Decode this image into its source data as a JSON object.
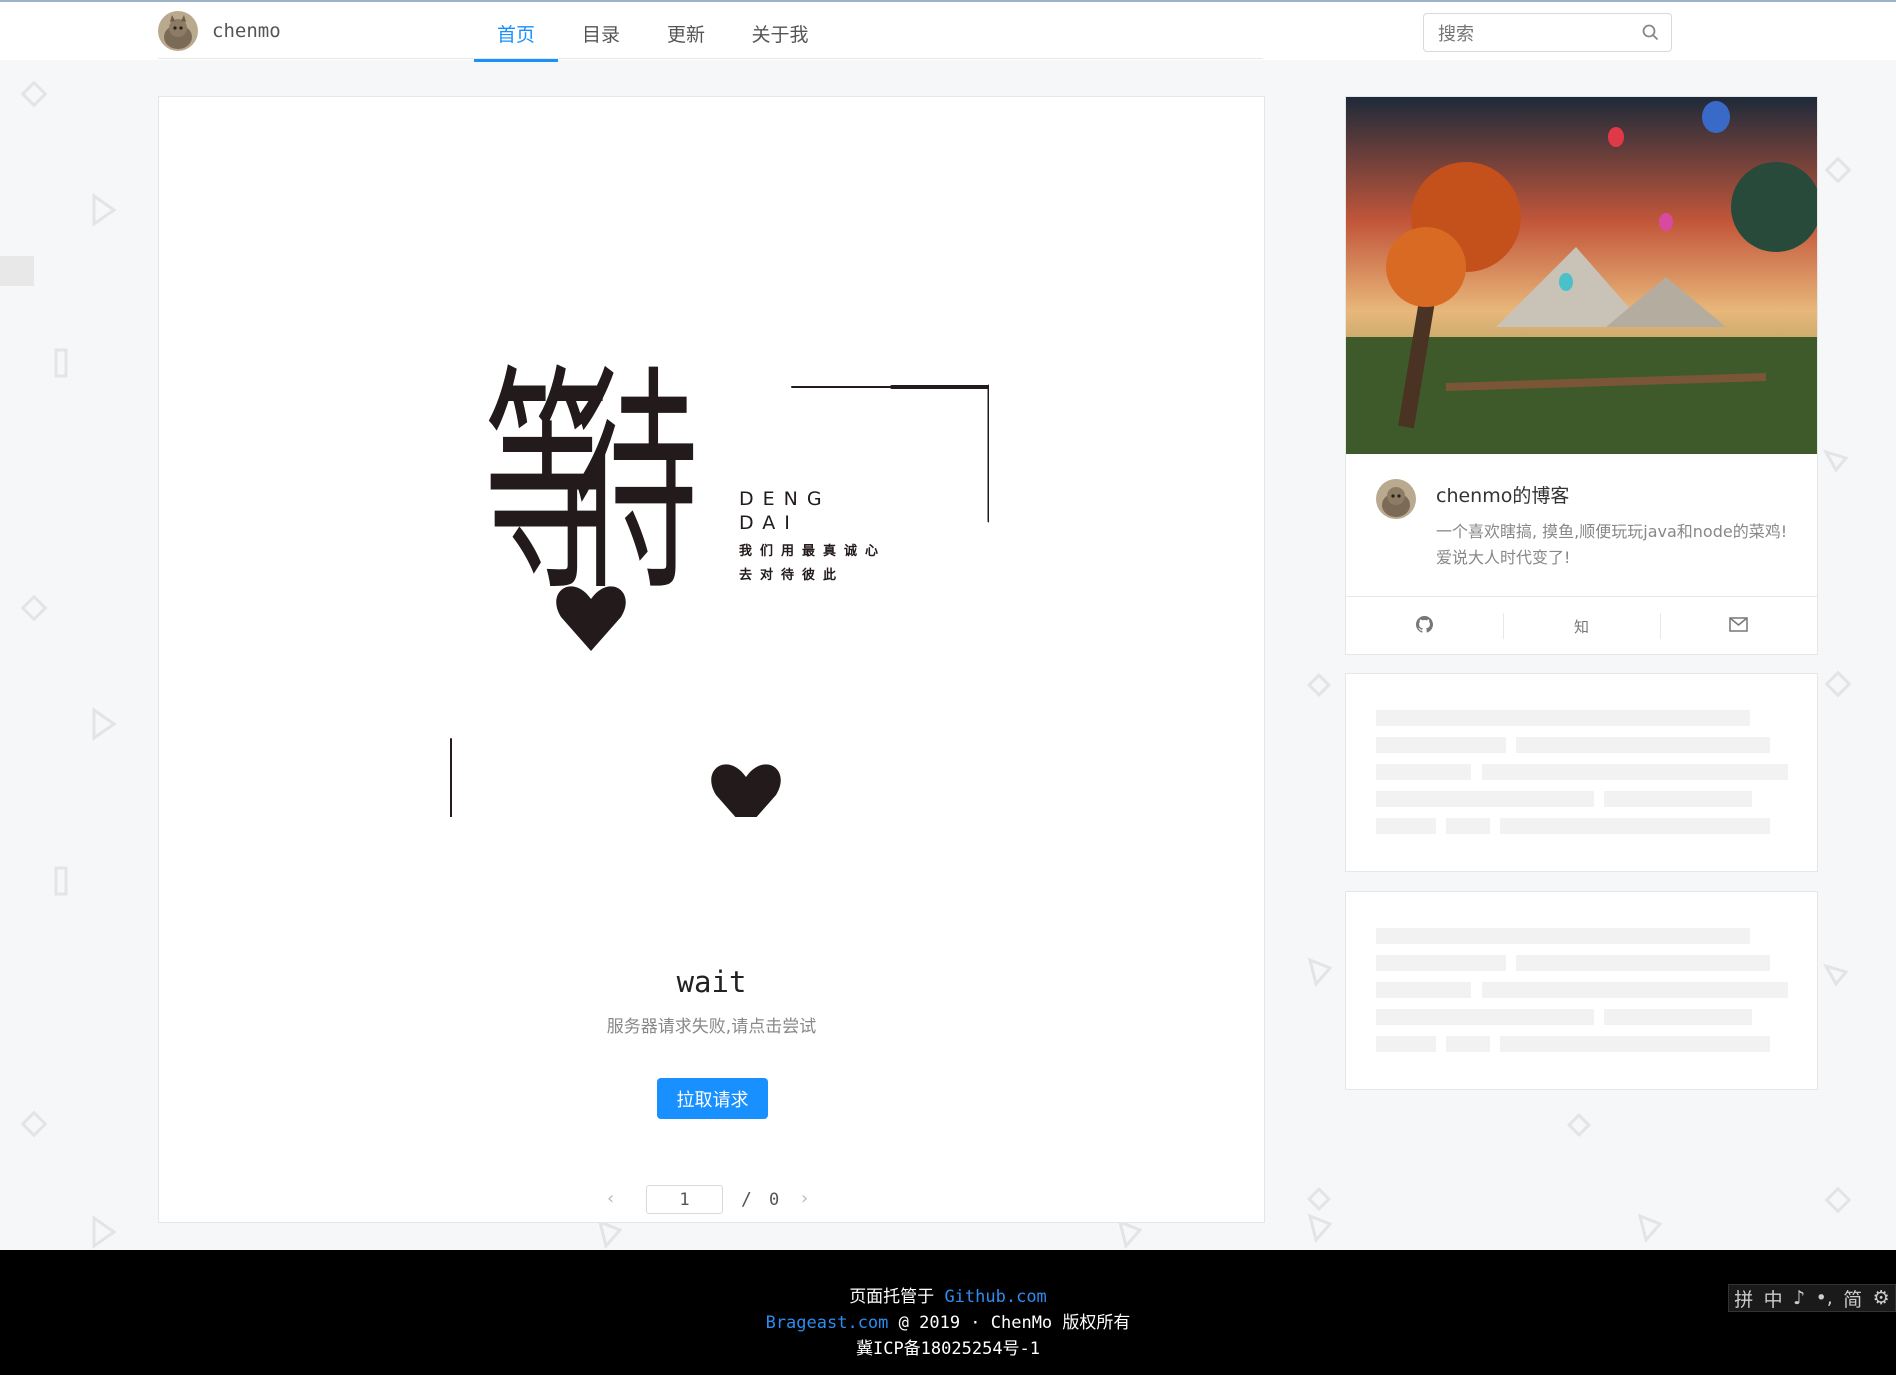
{
  "header": {
    "brand_name": "chenmo",
    "nav": [
      {
        "label": "首页",
        "active": true
      },
      {
        "label": "目录",
        "active": false
      },
      {
        "label": "更新",
        "active": false
      },
      {
        "label": "关于我",
        "active": false
      }
    ],
    "search_placeholder": "搜索"
  },
  "main": {
    "illustration": {
      "big_chars": "等待",
      "pinyin_line1": "DENG",
      "pinyin_line2": "DAI",
      "slogan_line1": "我们用最真诚心",
      "slogan_line2": "去对待彼此"
    },
    "title": "wait",
    "description": "服务器请求失败,请点击尝试",
    "retry_button": "拉取请求",
    "pager": {
      "current": "1",
      "separator": "/",
      "total": "0"
    }
  },
  "profile": {
    "name": "chenmo的博客",
    "description": "一个喜欢瞎搞, 摸鱼,顺便玩玩java和node的菜鸡!爱说大人时代变了!",
    "links": [
      {
        "icon": "github-icon",
        "label": ""
      },
      {
        "icon": "zhihu-icon",
        "label": "知"
      },
      {
        "icon": "mail-icon",
        "label": ""
      }
    ]
  },
  "footer": {
    "line1_prefix": "页面托管于 ",
    "line1_link": "Github.com",
    "line2_link": "Brageast.com",
    "line2_suffix": " @ 2019 · ChenMo 版权所有",
    "line3": "冀ICP备18025254号-1"
  },
  "ime_toolbar": {
    "items": [
      "拼",
      "中",
      "♪",
      "•,",
      "简",
      "⚙"
    ]
  },
  "colors": {
    "accent": "#1890ff",
    "footer_bg": "#000000",
    "link": "#2d8cf0",
    "page_bg": "#f6f7f8"
  }
}
